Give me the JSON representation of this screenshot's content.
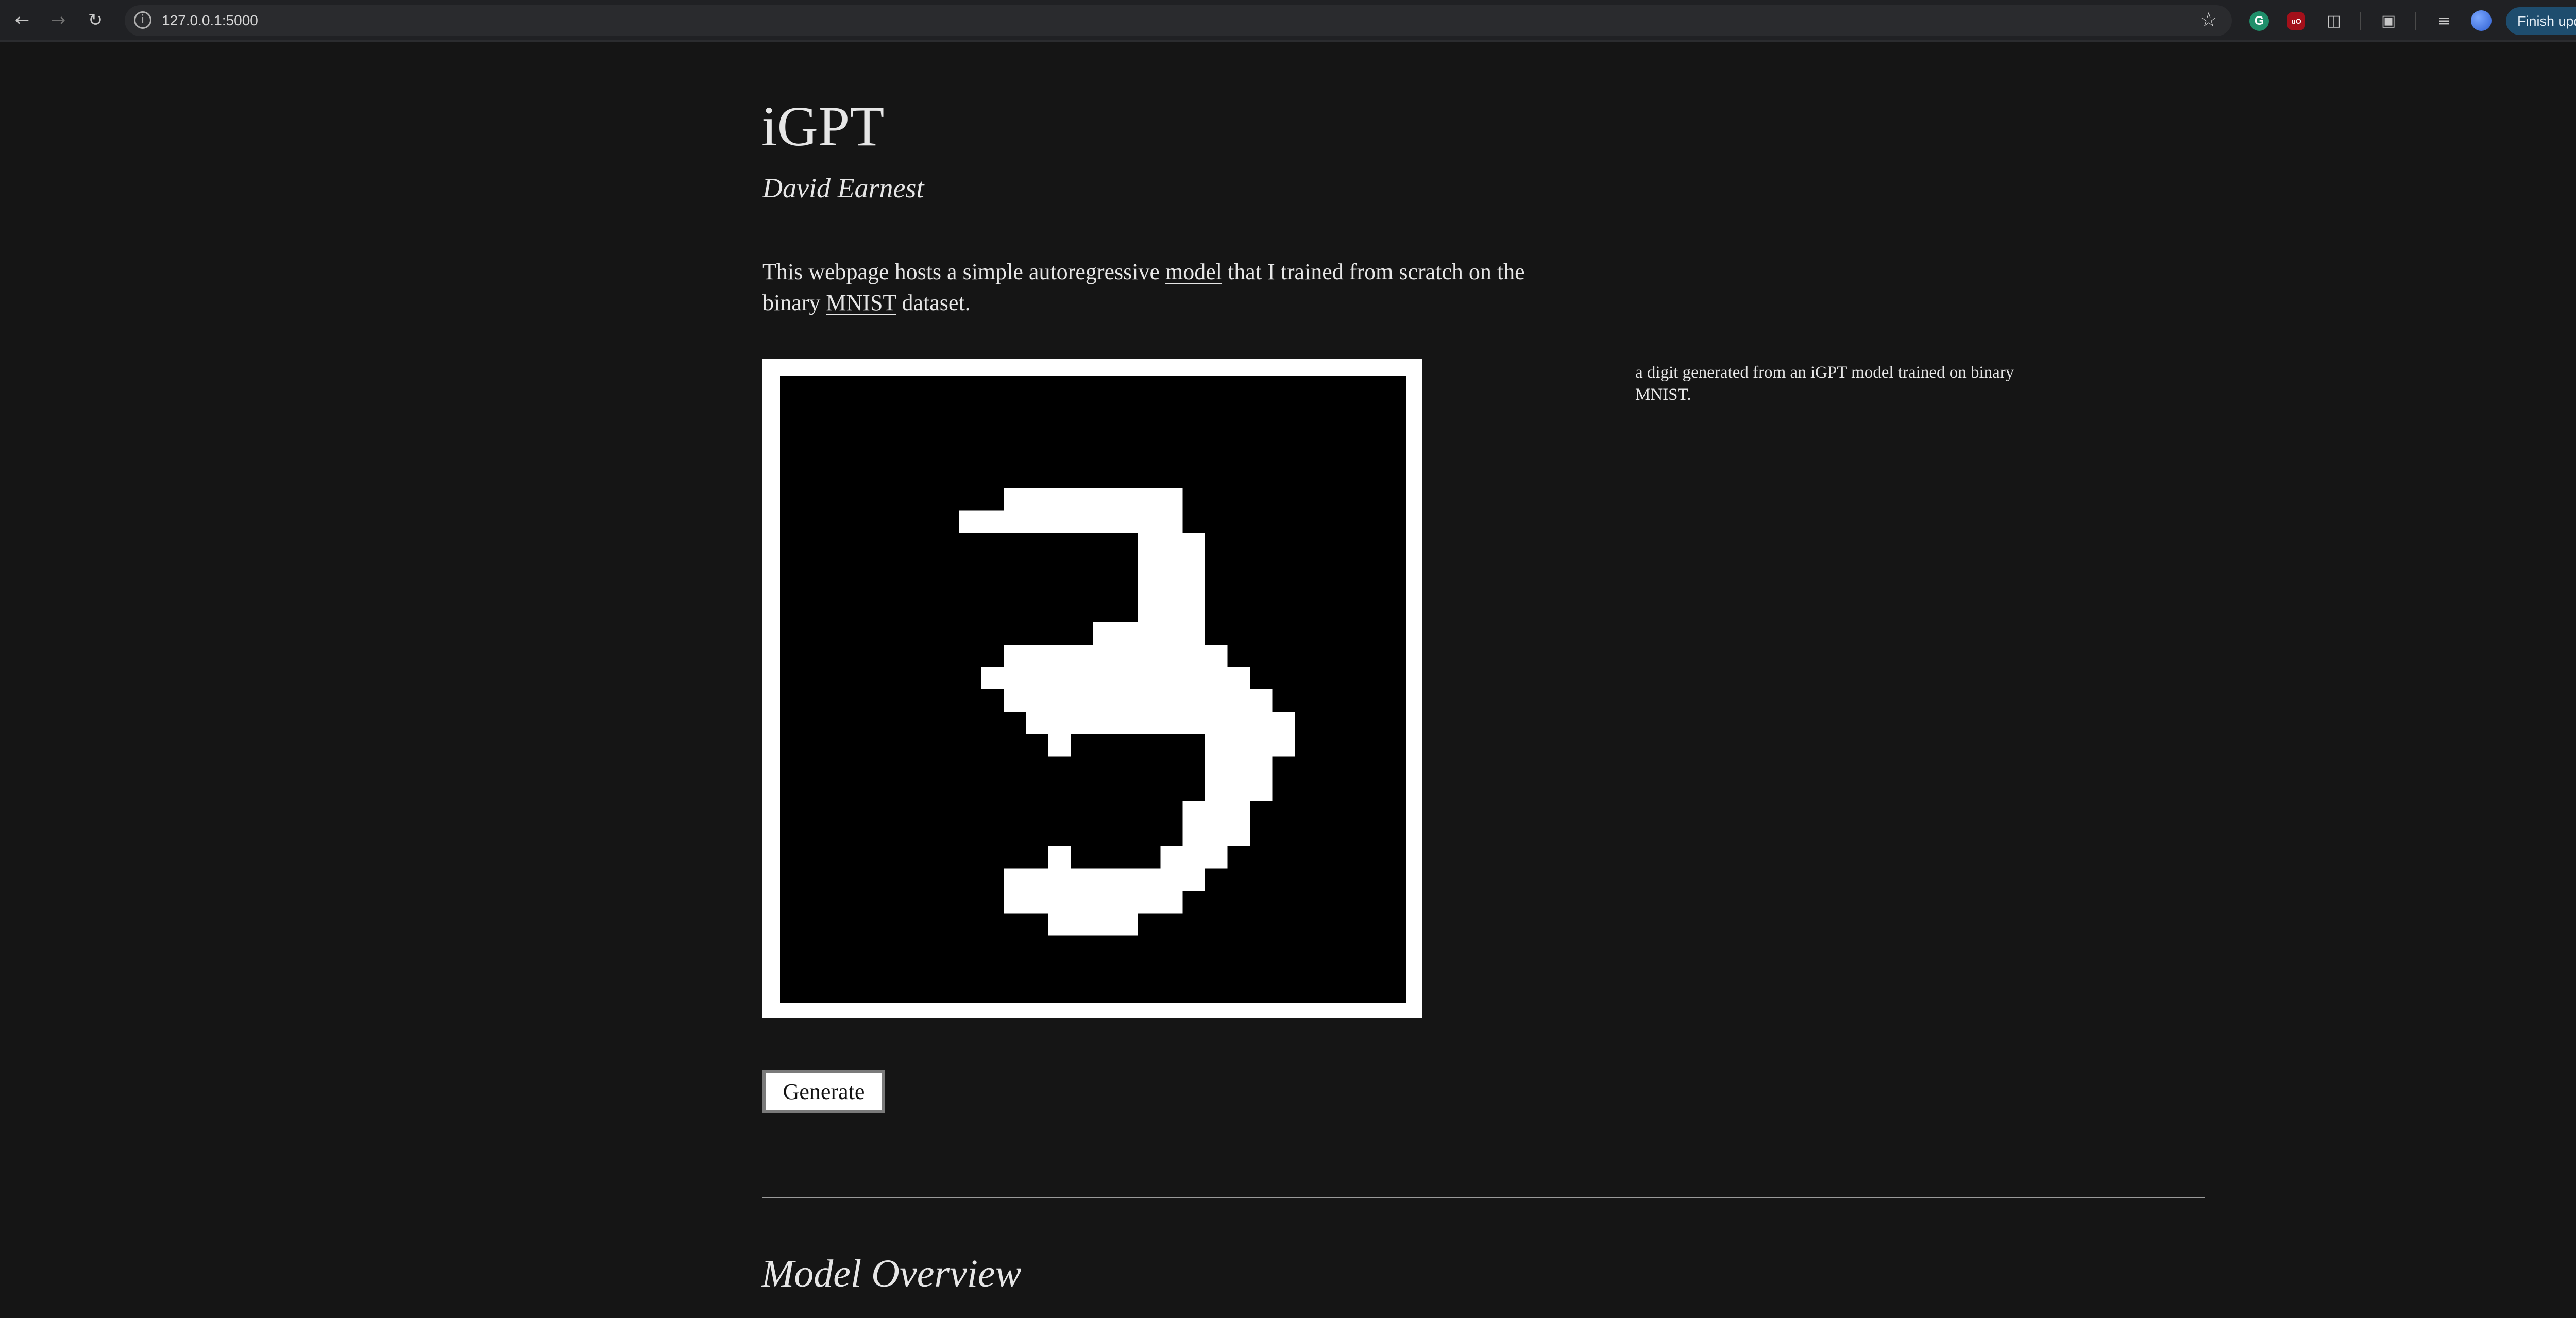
{
  "browser": {
    "url": "127.0.0.1:5000",
    "back_icon": "arrow-left-icon",
    "forward_icon": "arrow-right-icon",
    "reload_icon": "reload-icon",
    "update_button_label": "Finish update"
  },
  "page": {
    "title": "iGPT",
    "author": "David Earnest",
    "intro": {
      "before_model": "This webpage hosts a simple autoregressive ",
      "model_link": "model",
      "middle": " that I trained from scratch on the binary ",
      "mnist_link": "MNIST",
      "after": " dataset."
    },
    "caption": "a digit generated from an iGPT model trained on binary MNIST.",
    "generate_button_label": "Generate",
    "section_heading": "Model Overview"
  },
  "digit": {
    "grid_size": 28,
    "rows": [
      "0000000000000000000000000000",
      "0000000000000000000000000000",
      "0000000000000000000000000000",
      "0000000000000000000000000000",
      "0000000000000000000000000000",
      "0000000000111111110000000000",
      "0000000011111111110000000000",
      "0000000000000000111000000000",
      "0000000000000000111000000000",
      "0000000000000000111000000000",
      "0000000000000000111000000000",
      "0000000000000011111000000000",
      "0000000000111111111100000000",
      "0000000001111111111110000000",
      "0000000000111111111111000000",
      "0000000000011111111111100000",
      "0000000000001000000111100000",
      "0000000000000000000111000000",
      "0000000000000000000111000000",
      "0000000000000000001110000000",
      "0000000000000000001110000000",
      "0000000000001000011100000000",
      "0000000000111111111000000000",
      "0000000000111111110000000000",
      "0000000000001111000000000000",
      "0000000000000000000000000000",
      "0000000000000000000000000000",
      "0000000000000000000000000000"
    ],
    "on_color": "#ffffff",
    "off_color": "#000000"
  }
}
